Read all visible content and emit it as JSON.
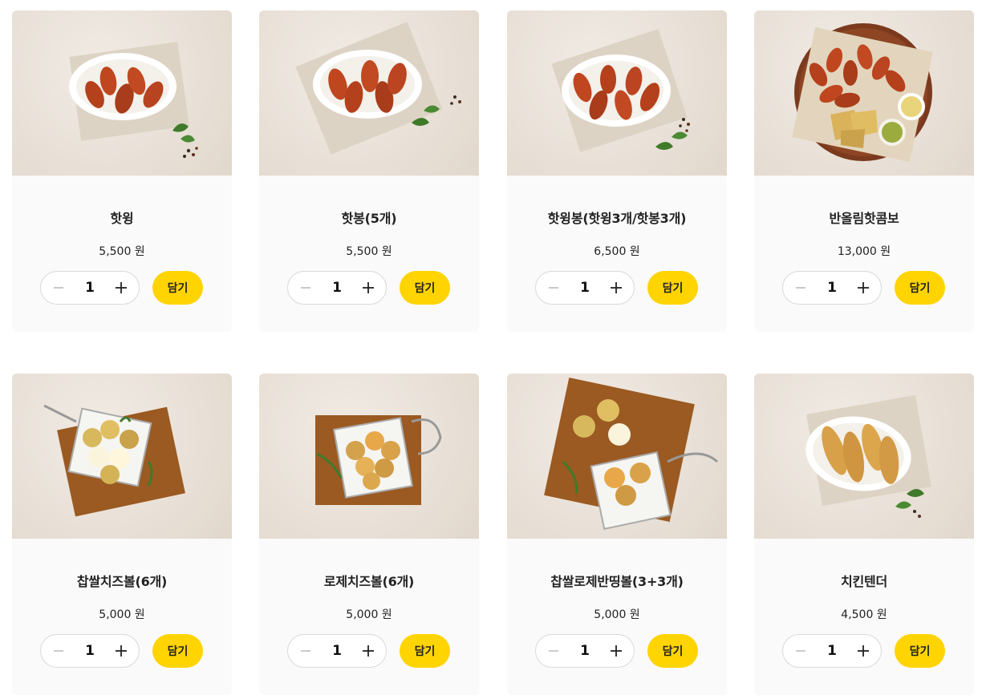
{
  "products": [
    {
      "name": "핫윙",
      "price": "5,500 원",
      "qty": "1",
      "add_label": "담기"
    },
    {
      "name": "핫봉(5개)",
      "price": "5,500 원",
      "qty": "1",
      "add_label": "담기"
    },
    {
      "name": "핫윙봉(핫윙3개/핫봉3개)",
      "price": "6,500 원",
      "qty": "1",
      "add_label": "담기"
    },
    {
      "name": "반올림핫콤보",
      "price": "13,000 원",
      "qty": "1",
      "add_label": "담기"
    },
    {
      "name": "찹쌀치즈볼(6개)",
      "price": "5,000 원",
      "qty": "1",
      "add_label": "담기"
    },
    {
      "name": "로제치즈볼(6개)",
      "price": "5,000 원",
      "qty": "1",
      "add_label": "담기"
    },
    {
      "name": "찹쌀로제반띵볼(3+3개)",
      "price": "5,000 원",
      "qty": "1",
      "add_label": "담기"
    },
    {
      "name": "치킨텐더",
      "price": "4,500 원",
      "qty": "1",
      "add_label": "담기"
    }
  ],
  "colors": {
    "accent": "#ffd400",
    "card_bg": "#fafafa",
    "photo_bg": "#e9e1d8"
  }
}
